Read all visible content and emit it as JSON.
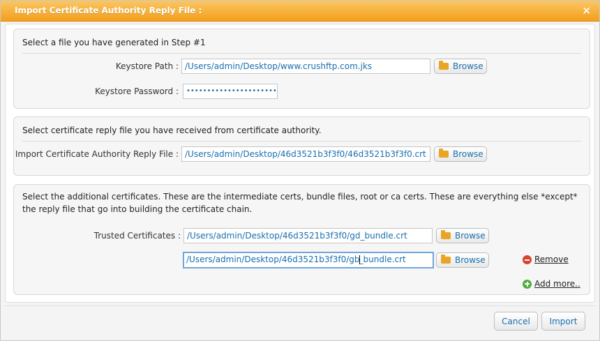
{
  "dialog": {
    "title": "Import Certificate Authority Reply File :",
    "close_glyph": "×"
  },
  "step1": {
    "heading": "Select a file you have generated in Step #1",
    "keystore_path_label": "Keystore Path :",
    "keystore_path_value": "/Users/admin/Desktop/www.crushftp.com.jks",
    "keystore_password_label": "Keystore Password :",
    "keystore_password_value": "•••••••••••••••••••••••",
    "browse_label": "Browse"
  },
  "reply": {
    "heading": "Select certificate reply file you have received from certificate authority.",
    "label": "Import Certificate Authority Reply File :",
    "value": "/Users/admin/Desktop/46d3521b3f3f0/46d3521b3f3f0.crt",
    "browse_label": "Browse"
  },
  "trusted": {
    "heading": "Select the additional certificates. These are the intermediate certs, bundle files, root or ca certs. These are everything else *except* the reply file that go into building the certificate chain.",
    "label": "Trusted Certificates :",
    "entries": [
      {
        "value": "/Users/admin/Desktop/46d3521b3f3f0/gd_bundle.crt",
        "browse_label": "Browse"
      },
      {
        "value_before_caret": "/Users/admin/Desktop/46d3521b3f3f0/gb",
        "value_after_caret": "_bundle.crt",
        "browse_label": "Browse",
        "remove_label": "Remove"
      }
    ],
    "add_more_label": "Add more.."
  },
  "footer": {
    "cancel_label": "Cancel",
    "import_label": "Import"
  }
}
